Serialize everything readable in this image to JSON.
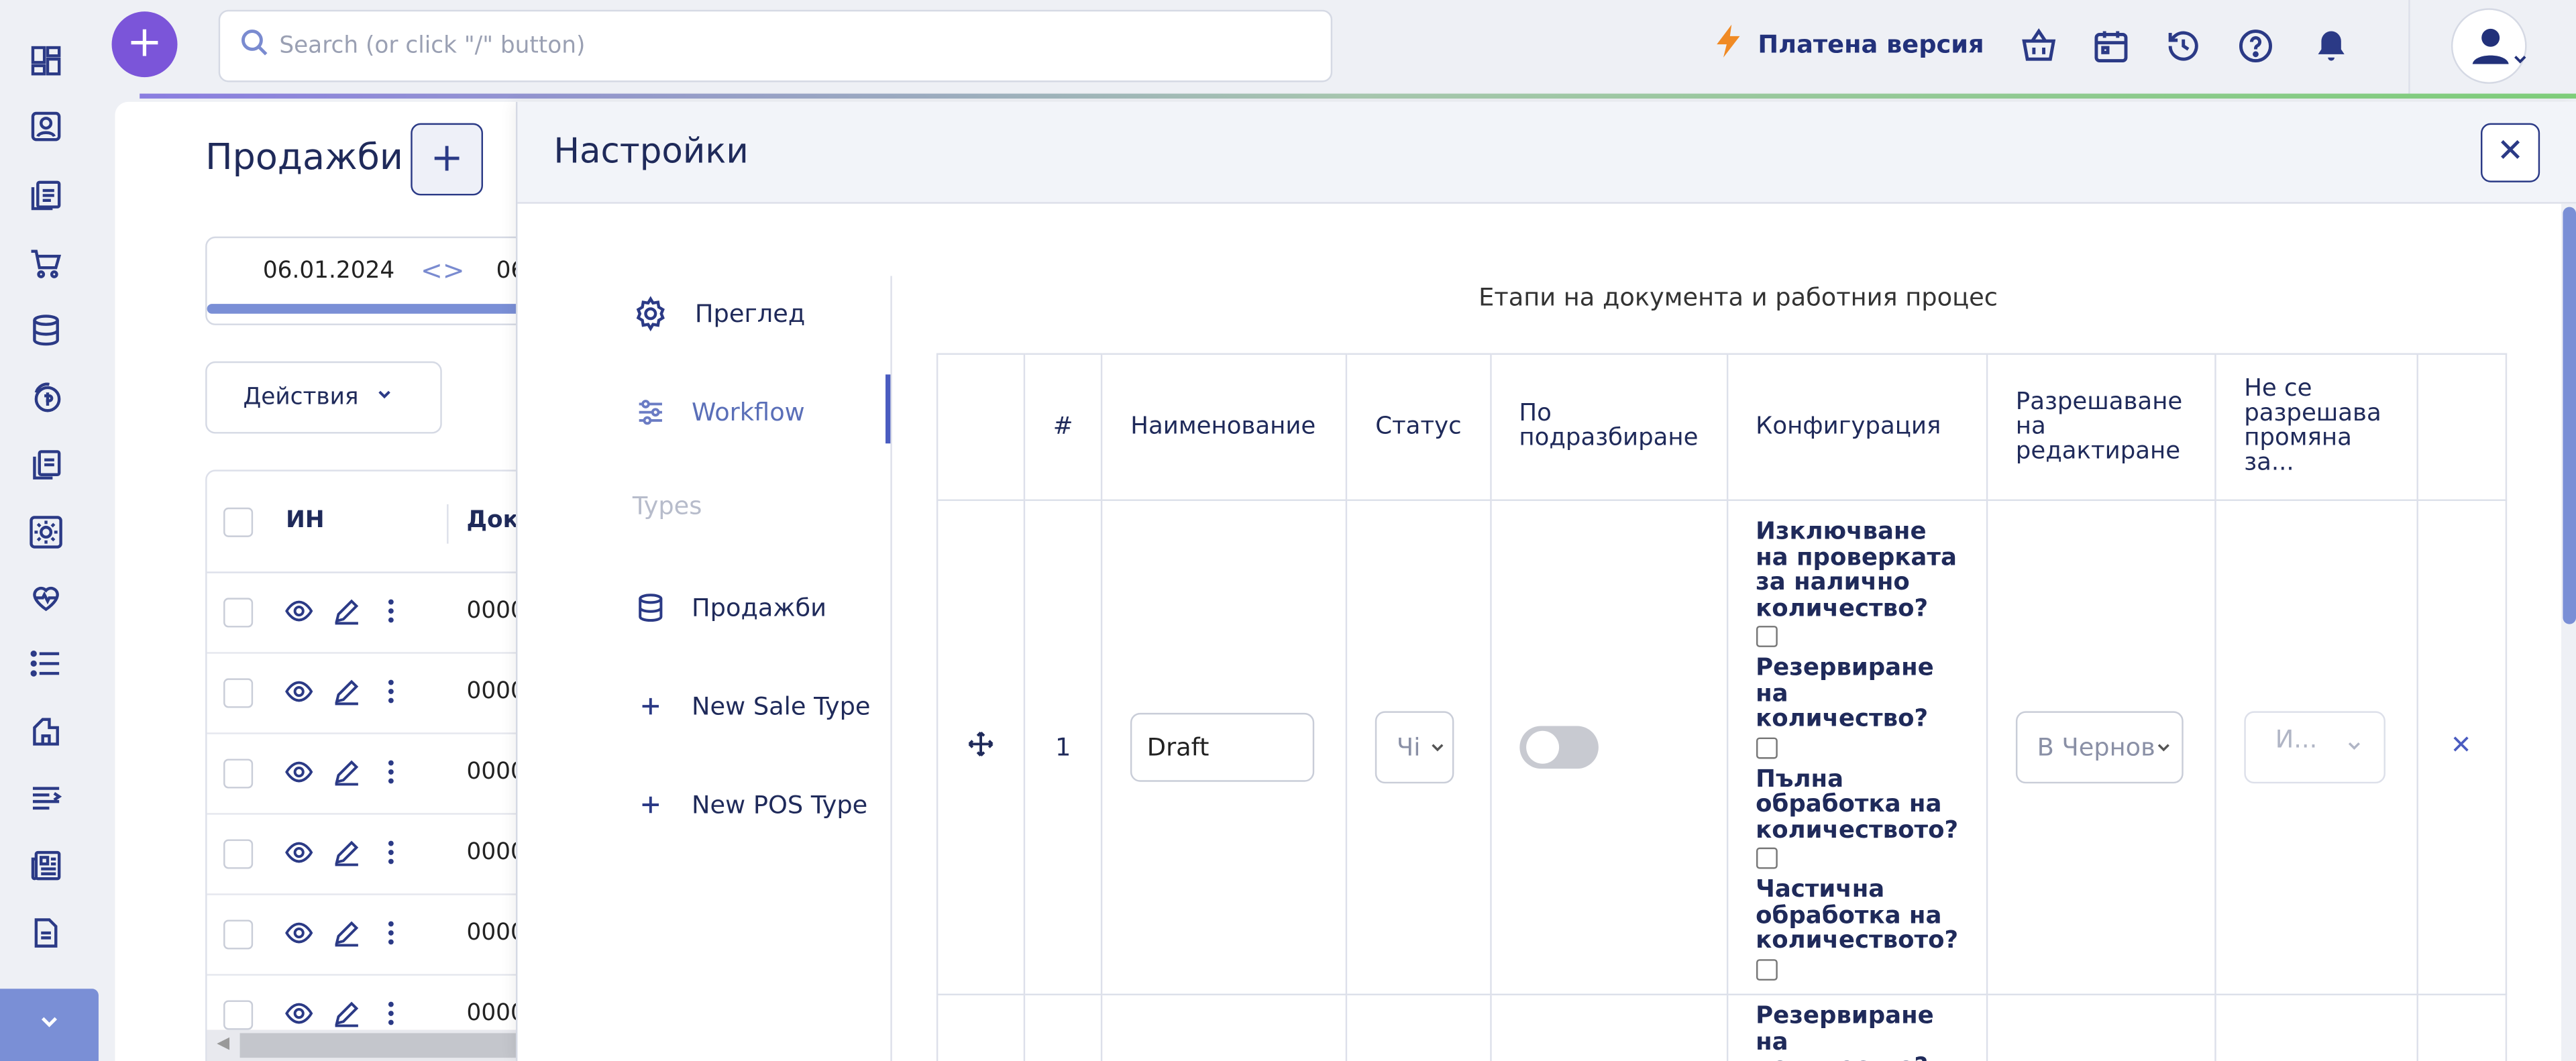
{
  "topbar": {
    "search_placeholder": "Search (or click \"/\" button)",
    "paid_version": "Платена версия",
    "icons": [
      "basket-icon",
      "calendar-icon",
      "history-icon",
      "help-icon",
      "bell-icon"
    ]
  },
  "sidebar": {
    "icons": [
      "dashboard-icon",
      "contacts-icon",
      "documents-icon",
      "cart-icon",
      "database-icon",
      "coins-icon",
      "copy-icon",
      "settings-icon",
      "heart-icon",
      "list-icon",
      "reports-icon",
      "text-icon",
      "newspaper-icon",
      "file-icon"
    ]
  },
  "page": {
    "title": "Продажби",
    "date_from": "06.01.2024",
    "date_to_partial": "06",
    "actions_label": "Действия",
    "grid": {
      "columns": [
        "ИН",
        "Доку"
      ],
      "rows": [
        "0000",
        "0000",
        "0000",
        "0000",
        "0000",
        "0000"
      ]
    }
  },
  "settings": {
    "title": "Настройки",
    "nav": [
      {
        "label": "Преглед",
        "icon": "gear-icon"
      },
      {
        "label": "Workflow",
        "icon": "sliders-icon"
      },
      {
        "label": "Types",
        "icon": ""
      },
      {
        "label": "Продажби",
        "icon": "database-icon"
      },
      {
        "label": "New Sale Type",
        "icon": "plus-icon"
      },
      {
        "label": "New POS Type",
        "icon": "plus-icon"
      }
    ],
    "table_title": "Етапи на документа и работния процес",
    "columns": [
      "",
      "#",
      "Наименование",
      "Статус",
      "По подразбиране",
      "Конфигурация",
      "Разрешаване на редактиране",
      "Не се разрешава промяна за...",
      ""
    ],
    "rows": [
      {
        "index": "1",
        "name": "Draft",
        "status_partial": "Чі",
        "default": false,
        "config": [
          "Изключване на проверката за налично количество?",
          "Резервиране на количество?",
          "Пълна обработка на количеството?",
          "Частична обработка на количеството?"
        ],
        "edit_permission": "В Чернов",
        "no_change_partial": "И..."
      }
    ],
    "row2_config_first": "Резервиране на количество?"
  },
  "colors": {
    "accent": "#2b3a86",
    "fab": "#7b55d9",
    "rail_toggle": "#7a8fd6",
    "paid_bolt": "#f08a24"
  }
}
